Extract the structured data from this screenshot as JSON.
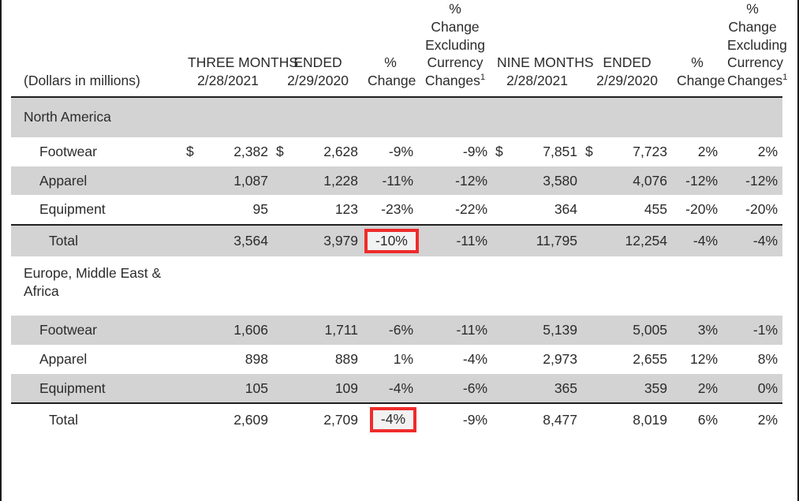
{
  "document": {
    "units_label": "(Dollars in millions)",
    "footnote_marker": "1"
  },
  "colors": {
    "highlight_border": "#ef2b2b",
    "row_shade": "#d3d3d3",
    "rule": "#1f1f1f",
    "text": "#2b2b2b"
  },
  "header": {
    "three_months_line1": "THREE MONTHS",
    "three_months_line2": "ENDED",
    "nine_months_line1": "NINE MONTHS",
    "nine_months_line2": "ENDED",
    "pct_symbol": "%",
    "change_word": "Change",
    "excl_l1": "%",
    "excl_l2": "Change",
    "excl_l3": "Excluding",
    "excl_l4": "Currency",
    "excl_l5": "Changes",
    "q_date_2021": "2/28/2021",
    "q_date_2020": "2/29/2020",
    "n_date_2021": "2/28/2021",
    "n_date_2020": "2/29/2020"
  },
  "sections": [
    {
      "name": "North America",
      "style": "shaded-band",
      "rows": [
        {
          "label": "Footwear",
          "shaded": false,
          "total": false,
          "q_cur1": "$",
          "q_val1": "2,382",
          "q_cur2": "$",
          "q_val2": "2,628",
          "q_pct": "-9%",
          "q_pct_excl": "-9%",
          "n_cur1": "$",
          "n_val1": "7,851",
          "n_cur2": "$",
          "n_val2": "7,723",
          "n_pct": "2%",
          "n_pct_excl": "2%",
          "q_pct_highlight": false
        },
        {
          "label": "Apparel",
          "shaded": true,
          "total": false,
          "q_cur1": "",
          "q_val1": "1,087",
          "q_cur2": "",
          "q_val2": "1,228",
          "q_pct": "-11%",
          "q_pct_excl": "-12%",
          "n_cur1": "",
          "n_val1": "3,580",
          "n_cur2": "",
          "n_val2": "4,076",
          "n_pct": "-12%",
          "n_pct_excl": "-12%",
          "q_pct_highlight": false
        },
        {
          "label": "Equipment",
          "shaded": false,
          "total": false,
          "q_cur1": "",
          "q_val1": "95",
          "q_cur2": "",
          "q_val2": "123",
          "q_pct": "-23%",
          "q_pct_excl": "-22%",
          "n_cur1": "",
          "n_val1": "364",
          "n_cur2": "",
          "n_val2": "455",
          "n_pct": "-20%",
          "n_pct_excl": "-20%",
          "q_pct_highlight": false
        },
        {
          "label": "Total",
          "shaded": true,
          "total": true,
          "q_cur1": "",
          "q_val1": "3,564",
          "q_cur2": "",
          "q_val2": "3,979",
          "q_pct": "-10%",
          "q_pct_excl": "-11%",
          "n_cur1": "",
          "n_val1": "11,795",
          "n_cur2": "",
          "n_val2": "12,254",
          "n_pct": "-4%",
          "n_pct_excl": "-4%",
          "q_pct_highlight": true
        }
      ]
    },
    {
      "name": "Europe, Middle East & Africa",
      "name_line1": "Europe, Middle East &",
      "name_line2": "Africa",
      "style": "white-two-line",
      "rows": [
        {
          "label": "Footwear",
          "shaded": true,
          "total": false,
          "q_cur1": "",
          "q_val1": "1,606",
          "q_cur2": "",
          "q_val2": "1,711",
          "q_pct": "-6%",
          "q_pct_excl": "-11%",
          "n_cur1": "",
          "n_val1": "5,139",
          "n_cur2": "",
          "n_val2": "5,005",
          "n_pct": "3%",
          "n_pct_excl": "-1%",
          "q_pct_highlight": false
        },
        {
          "label": "Apparel",
          "shaded": false,
          "total": false,
          "q_cur1": "",
          "q_val1": "898",
          "q_cur2": "",
          "q_val2": "889",
          "q_pct": "1%",
          "q_pct_excl": "-4%",
          "n_cur1": "",
          "n_val1": "2,973",
          "n_cur2": "",
          "n_val2": "2,655",
          "n_pct": "12%",
          "n_pct_excl": "8%",
          "q_pct_highlight": false
        },
        {
          "label": "Equipment",
          "shaded": true,
          "total": false,
          "q_cur1": "",
          "q_val1": "105",
          "q_cur2": "",
          "q_val2": "109",
          "q_pct": "-4%",
          "q_pct_excl": "-6%",
          "n_cur1": "",
          "n_val1": "365",
          "n_cur2": "",
          "n_val2": "359",
          "n_pct": "2%",
          "n_pct_excl": "0%",
          "q_pct_highlight": false
        },
        {
          "label": "Total",
          "shaded": false,
          "total": true,
          "q_cur1": "",
          "q_val1": "2,609",
          "q_cur2": "",
          "q_val2": "2,709",
          "q_pct": "-4%",
          "q_pct_excl": "-9%",
          "n_cur1": "",
          "n_val1": "8,477",
          "n_cur2": "",
          "n_val2": "8,019",
          "n_pct": "6%",
          "n_pct_excl": "2%",
          "q_pct_highlight": true
        }
      ]
    }
  ],
  "chart_data": {
    "type": "table",
    "title": "Revenues by Segment and Product Line",
    "units": "(Dollars in millions)",
    "column_groups": [
      {
        "name": "THREE MONTHS ENDED",
        "columns": [
          "2/28/2021",
          "2/29/2020",
          "% Change",
          "% Change Excluding Currency Changes"
        ]
      },
      {
        "name": "NINE MONTHS ENDED",
        "columns": [
          "2/28/2021",
          "2/29/2020",
          "% Change",
          "% Change Excluding Currency Changes"
        ]
      }
    ],
    "rows": [
      {
        "segment": "North America",
        "line": "Footwear",
        "q_2021": 2382,
        "q_2020": 2628,
        "q_pct": -9,
        "q_pct_cc": -9,
        "n_2021": 7851,
        "n_2020": 7723,
        "n_pct": 2,
        "n_pct_cc": 2
      },
      {
        "segment": "North America",
        "line": "Apparel",
        "q_2021": 1087,
        "q_2020": 1228,
        "q_pct": -11,
        "q_pct_cc": -12,
        "n_2021": 3580,
        "n_2020": 4076,
        "n_pct": -12,
        "n_pct_cc": -12
      },
      {
        "segment": "North America",
        "line": "Equipment",
        "q_2021": 95,
        "q_2020": 123,
        "q_pct": -23,
        "q_pct_cc": -22,
        "n_2021": 364,
        "n_2020": 455,
        "n_pct": -20,
        "n_pct_cc": -20
      },
      {
        "segment": "North America",
        "line": "Total",
        "q_2021": 3564,
        "q_2020": 3979,
        "q_pct": -10,
        "q_pct_cc": -11,
        "n_2021": 11795,
        "n_2020": 12254,
        "n_pct": -4,
        "n_pct_cc": -4
      },
      {
        "segment": "Europe, Middle East & Africa",
        "line": "Footwear",
        "q_2021": 1606,
        "q_2020": 1711,
        "q_pct": -6,
        "q_pct_cc": -11,
        "n_2021": 5139,
        "n_2020": 5005,
        "n_pct": 3,
        "n_pct_cc": -1
      },
      {
        "segment": "Europe, Middle East & Africa",
        "line": "Apparel",
        "q_2021": 898,
        "q_2020": 889,
        "q_pct": 1,
        "q_pct_cc": -4,
        "n_2021": 2973,
        "n_2020": 2655,
        "n_pct": 12,
        "n_pct_cc": 8
      },
      {
        "segment": "Europe, Middle East & Africa",
        "line": "Equipment",
        "q_2021": 105,
        "q_2020": 109,
        "q_pct": -4,
        "q_pct_cc": -6,
        "n_2021": 365,
        "n_2020": 359,
        "n_pct": 2,
        "n_pct_cc": 0
      },
      {
        "segment": "Europe, Middle East & Africa",
        "line": "Total",
        "q_2021": 2609,
        "q_2020": 2709,
        "q_pct": -4,
        "q_pct_cc": -9,
        "n_2021": 8477,
        "n_2020": 8019,
        "n_pct": 6,
        "n_pct_cc": 2
      }
    ],
    "highlighted_cells": [
      {
        "segment": "North America",
        "line": "Total",
        "column": "% Change (three months)",
        "value": "-10%"
      },
      {
        "segment": "Europe, Middle East & Africa",
        "line": "Total",
        "column": "% Change (three months)",
        "value": "-4%"
      }
    ]
  }
}
